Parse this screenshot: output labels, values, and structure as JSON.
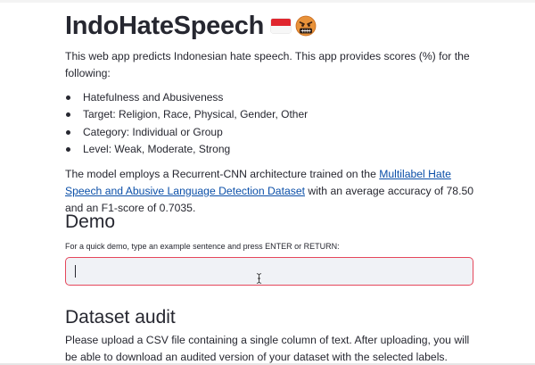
{
  "app": {
    "title": "IndoHateSpeech",
    "title_icons": [
      "indonesia-flag-icon",
      "angry-face-icon"
    ]
  },
  "intro": {
    "text": "This web app predicts Indonesian hate speech. This app provides scores (%) for the following:"
  },
  "features": [
    "Hatefulness and Abusiveness",
    "Target: Religion, Race, Physical, Gender, Other",
    "Category: Individual or Group",
    "Level: Weak, Moderate, Strong"
  ],
  "model": {
    "text_before": "The model employs a Recurrent-CNN architecture trained on the ",
    "link_text": "Multilabel Hate Speech and Abusive Language Detection Dataset",
    "text_after": " with an average accuracy of 78.50 and an F1-score of 0.7035."
  },
  "demo": {
    "heading": "Demo",
    "hint": "For a quick demo, type an example sentence and press ENTER or RETURN:",
    "input_value": "",
    "input_placeholder": ""
  },
  "audit": {
    "heading": "Dataset audit",
    "description": "Please upload a CSV file containing a single column of text. After uploading, you will be able to download an audited version of your dataset with the selected labels."
  },
  "colors": {
    "text": "#262730",
    "link": "#0b4fa8",
    "input_focus_border": "#e5475b",
    "input_background": "#f0f2f6",
    "flag_red": "#e0262e",
    "flag_white": "#f7f7f7"
  }
}
